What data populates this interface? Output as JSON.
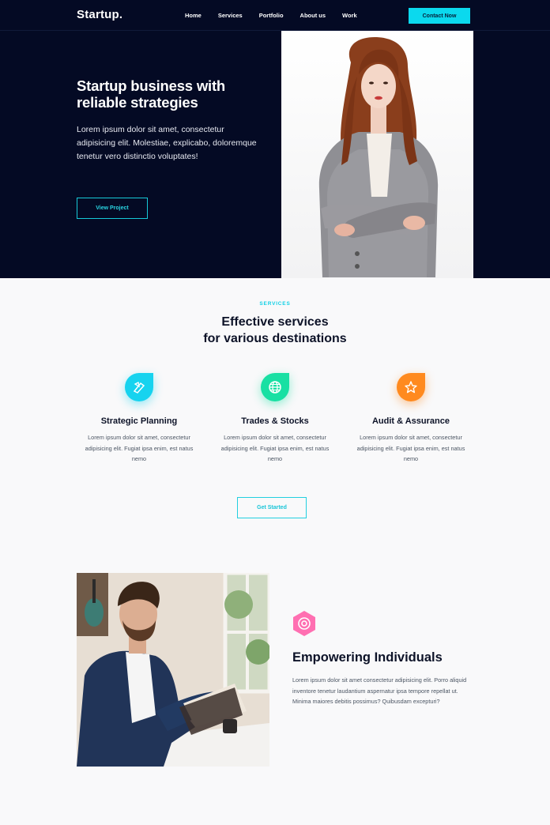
{
  "nav": {
    "logo": "Startup.",
    "links": [
      "Home",
      "Services",
      "Portfolio",
      "About us",
      "Work"
    ],
    "cta": "Contact Now"
  },
  "hero": {
    "title": "Startup business with reliable strategies",
    "text": "Lorem ipsum dolor sit amet, consectetur adipisicing elit. Molestiae, explicabo, doloremque tenetur vero distinctio voluptates!",
    "button": "View Project"
  },
  "services": {
    "eyebrow": "SERVICES",
    "title_line1": "Effective services",
    "title_line2": "for various destinations",
    "items": [
      {
        "title": "Strategic Planning",
        "text": "Lorem ipsum dolor sit amet, consectetur adipisicing elit. Fugiat ipsa enim, est natus nemo",
        "icon": "wand-icon",
        "color": "#16d3ef"
      },
      {
        "title": "Trades & Stocks",
        "text": "Lorem ipsum dolor sit amet, consectetur adipisicing elit. Fugiat ipsa enim, est natus nemo",
        "icon": "globe-icon",
        "color": "#18e0a3"
      },
      {
        "title": "Audit & Assurance",
        "text": "Lorem ipsum dolor sit amet, consectetur adipisicing elit. Fugiat ipsa enim, est natus nemo",
        "icon": "star-icon",
        "color": "#ff8a1f"
      }
    ],
    "button": "Get Started"
  },
  "empower": {
    "title": "Empowering Individuals",
    "text": "Lorem ipsum dolor sit amet consectetur adipisicing elit. Porro aliquid inventore tenetur laudantium aspernatur ipsa tempore repellat ut. Minima maiores debitis possimus? Quibusdam excepturi?",
    "icon": "target-icon",
    "icon_color": "#ff5fa8"
  },
  "colors": {
    "dark": "#040a24",
    "accent": "#0bd9ee"
  }
}
